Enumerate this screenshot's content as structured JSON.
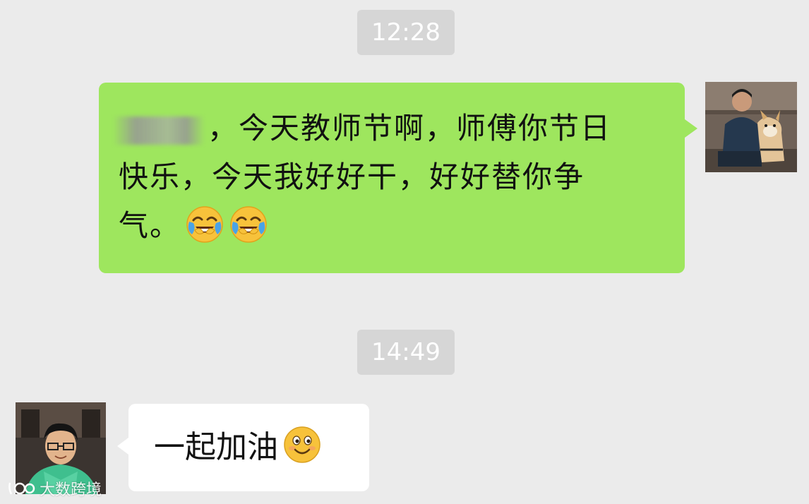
{
  "chat": {
    "timestamps": [
      "12:28",
      "14:49"
    ],
    "messages": [
      {
        "sender": "self",
        "text_line1": "，今天教师节啊，师傅你节日",
        "text_line2": "快乐，今天我好好干，好好替你争",
        "text_line3": "气。",
        "emojis": [
          "tears-of-joy-icon",
          "tears-of-joy-icon"
        ],
        "bubble_color": "#9ee65e"
      },
      {
        "sender": "other",
        "text": "一起加油",
        "emojis": [
          "smile-icon"
        ],
        "bubble_color": "#ffffff"
      }
    ]
  },
  "watermark": {
    "text": "大数跨境"
  },
  "colors": {
    "background": "#ebebeb",
    "timestamp_bg": "#d6d6d6"
  }
}
